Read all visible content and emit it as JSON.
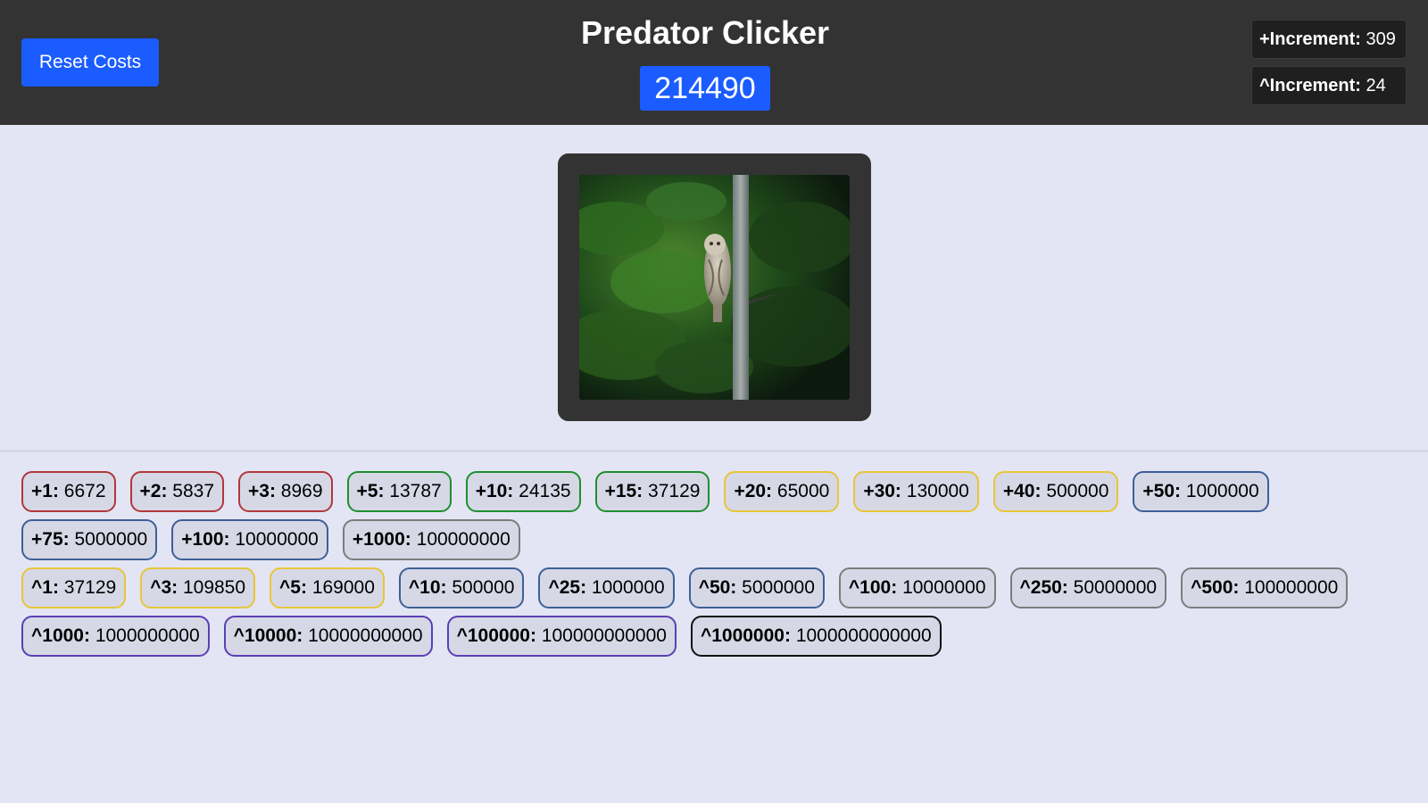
{
  "header": {
    "reset_label": "Reset Costs",
    "title": "Predator Clicker",
    "score": "214490",
    "plus_increment_label": "+Increment:",
    "plus_increment_value": "309",
    "pow_increment_label": "^Increment:",
    "pow_increment_value": "24"
  },
  "image": {
    "subject": "owl perched on tree trunk"
  },
  "rows": [
    [
      {
        "key": "+1:",
        "cost": "6672",
        "color": "red"
      },
      {
        "key": "+2:",
        "cost": "5837",
        "color": "red"
      },
      {
        "key": "+3:",
        "cost": "8969",
        "color": "red"
      },
      {
        "key": "+5:",
        "cost": "13787",
        "color": "green"
      },
      {
        "key": "+10:",
        "cost": "24135",
        "color": "green"
      },
      {
        "key": "+15:",
        "cost": "37129",
        "color": "green"
      },
      {
        "key": "+20:",
        "cost": "65000",
        "color": "yellow"
      },
      {
        "key": "+30:",
        "cost": "130000",
        "color": "yellow"
      },
      {
        "key": "+40:",
        "cost": "500000",
        "color": "yellow"
      },
      {
        "key": "+50:",
        "cost": "1000000",
        "color": "blue"
      }
    ],
    [
      {
        "key": "+75:",
        "cost": "5000000",
        "color": "blue"
      },
      {
        "key": "+100:",
        "cost": "10000000",
        "color": "blue"
      },
      {
        "key": "+1000:",
        "cost": "100000000",
        "color": "gray"
      }
    ],
    [
      {
        "key": "^1:",
        "cost": "37129",
        "color": "yellow"
      },
      {
        "key": "^3:",
        "cost": "109850",
        "color": "yellow"
      },
      {
        "key": "^5:",
        "cost": "169000",
        "color": "yellow"
      },
      {
        "key": "^10:",
        "cost": "500000",
        "color": "blue"
      },
      {
        "key": "^25:",
        "cost": "1000000",
        "color": "blue"
      },
      {
        "key": "^50:",
        "cost": "5000000",
        "color": "blue"
      },
      {
        "key": "^100:",
        "cost": "10000000",
        "color": "gray"
      },
      {
        "key": "^250:",
        "cost": "50000000",
        "color": "gray"
      },
      {
        "key": "^500:",
        "cost": "100000000",
        "color": "gray"
      }
    ],
    [
      {
        "key": "^1000:",
        "cost": "1000000000",
        "color": "purple"
      },
      {
        "key": "^10000:",
        "cost": "10000000000",
        "color": "purple"
      },
      {
        "key": "^100000:",
        "cost": "100000000000",
        "color": "purple"
      },
      {
        "key": "^1000000:",
        "cost": "1000000000000",
        "color": "black"
      }
    ]
  ],
  "colors": {
    "accent": "#1b5cff",
    "header_bg": "#333333",
    "page_bg": "#e3e5f4"
  }
}
